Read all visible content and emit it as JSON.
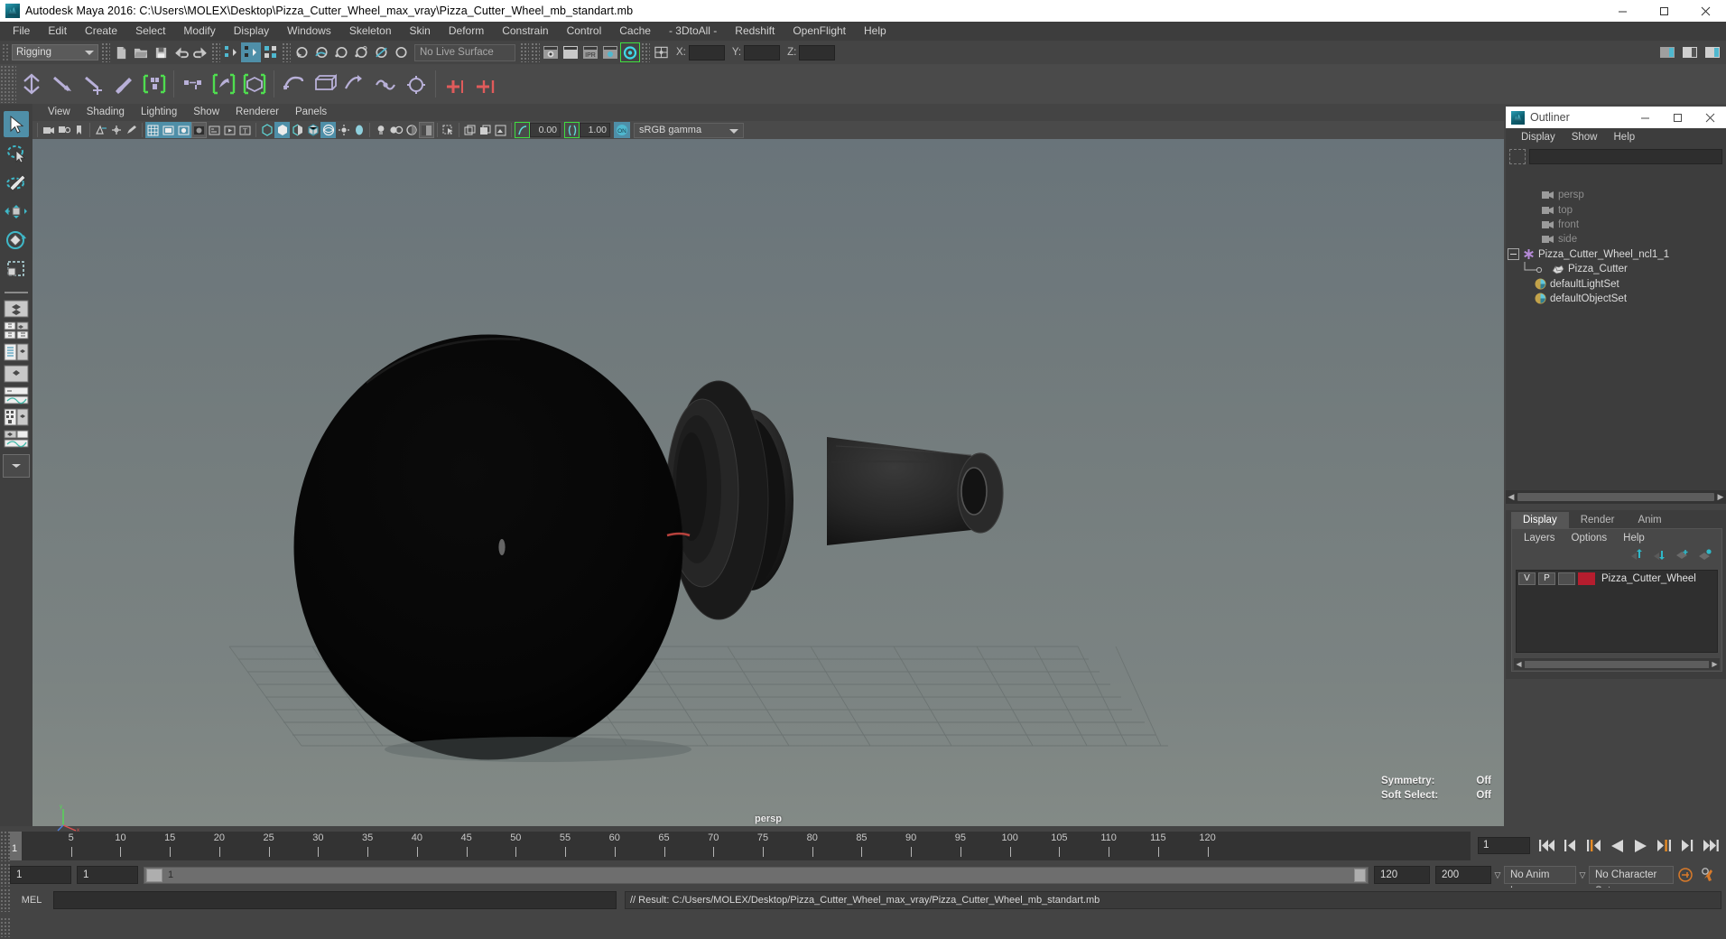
{
  "titlebar": {
    "title": "Autodesk Maya 2016: C:\\Users\\MOLEX\\Desktop\\Pizza_Cutter_Wheel_max_vray\\Pizza_Cutter_Wheel_mb_standart.mb",
    "app_icon": "maya-icon",
    "minimize": "—",
    "maximize": "☐",
    "close": "✕"
  },
  "menubar": {
    "items": [
      "File",
      "Edit",
      "Create",
      "Select",
      "Modify",
      "Display",
      "Windows",
      "Skeleton",
      "Skin",
      "Deform",
      "Constrain",
      "Control",
      "Cache",
      "- 3DtoAll -",
      "Redshift",
      "OpenFlight",
      "Help"
    ]
  },
  "statusline": {
    "menu_set": "Rigging",
    "live_surface": "No Live Surface",
    "coord_labels": {
      "x": "X:",
      "y": "Y:",
      "z": "Z:"
    },
    "coord_values": {
      "x": "",
      "y": "",
      "z": ""
    }
  },
  "panel": {
    "menu": [
      "View",
      "Shading",
      "Lighting",
      "Show",
      "Renderer",
      "Panels"
    ],
    "gamma_exposure": "0.00",
    "gamma_value": "1.00",
    "color_space": "sRGB gamma",
    "viewport_label": "persp",
    "hud": [
      {
        "label": "Symmetry:",
        "value": "Off"
      },
      {
        "label": "Soft Select:",
        "value": "Off"
      }
    ]
  },
  "outliner": {
    "title": "Outliner",
    "window_icon": "maya-icon",
    "minimize": "—",
    "maximize": "☐",
    "close": "✕",
    "menu": [
      "Display",
      "Show",
      "Help"
    ],
    "search_value": "",
    "items": [
      {
        "label": "persp",
        "icon": "camera-icon",
        "indent": 40,
        "dim": true
      },
      {
        "label": "top",
        "icon": "camera-icon",
        "indent": 40,
        "dim": true
      },
      {
        "label": "front",
        "icon": "camera-icon",
        "indent": 40,
        "dim": true
      },
      {
        "label": "side",
        "icon": "camera-icon",
        "indent": 40,
        "dim": true
      },
      {
        "label": "Pizza_Cutter_Wheel_ncl1_1",
        "icon": "asterisk-icon",
        "indent": 20,
        "dim": false,
        "expanded": true
      },
      {
        "label": "Pizza_Cutter",
        "icon": "mesh-icon",
        "indent": 48,
        "dim": false
      },
      {
        "label": "defaultLightSet",
        "icon": "set-icon",
        "indent": 32,
        "dim": false
      },
      {
        "label": "defaultObjectSet",
        "icon": "set-icon",
        "indent": 32,
        "dim": false
      }
    ]
  },
  "layer_editor": {
    "tabs": [
      "Display",
      "Render",
      "Anim"
    ],
    "active_tab": "Display",
    "menu": [
      "Layers",
      "Options",
      "Help"
    ],
    "toolbar_icons": [
      "move-layer-up-icon",
      "move-layer-down-icon",
      "new-layer-icon",
      "new-layer-from-selection-icon"
    ],
    "layers": [
      {
        "visibility": "V",
        "playback": "P",
        "shading": "",
        "color": "#b51d2e",
        "name": "Pizza_Cutter_Wheel"
      }
    ]
  },
  "timeline": {
    "ticks": [
      5,
      10,
      15,
      20,
      25,
      30,
      35,
      40,
      45,
      50,
      55,
      60,
      65,
      70,
      75,
      80,
      85,
      90,
      95,
      100,
      105,
      110,
      115,
      120
    ],
    "current_frame_marker": "1",
    "current_frame_field": "1",
    "playback_buttons": [
      "go-to-start-icon",
      "step-back-keyframe-icon",
      "step-back-frame-icon",
      "play-backwards-icon",
      "play-forwards-icon",
      "step-forward-frame-icon",
      "step-forward-keyframe-icon",
      "go-to-end-icon"
    ]
  },
  "range_slider": {
    "start_field": "1",
    "range_start_field": "1",
    "slider_label": "1",
    "range_end_field": "120",
    "end_field": "200",
    "anim_layer": "No Anim Layer",
    "character_set": "No Character Set"
  },
  "command_line": {
    "language": "MEL",
    "input_value": "",
    "result": "// Result: C:/Users/MOLEX/Desktop/Pizza_Cutter_Wheel_max_vray/Pizza_Cutter_Wheel_mb_standart.mb"
  },
  "toolbox": {
    "items": [
      {
        "name": "select-tool",
        "active": true
      },
      {
        "name": "lasso-select-tool",
        "active": false
      },
      {
        "name": "paint-select-tool",
        "active": false
      },
      {
        "name": "move-tool",
        "active": false
      },
      {
        "name": "rotate-tool",
        "active": false
      },
      {
        "name": "scale-tool",
        "active": false
      }
    ],
    "layout_items": [
      "single-perspective-layout",
      "four-view-layout",
      "outliner-persp-layout",
      "hypergraph-persp-layout",
      "persp-graph-editor-layout",
      "hypershade-persp-layout",
      "persp-outliner-graph-layout",
      "layout-menu"
    ]
  },
  "colors": {
    "accent": "#4f8fa8",
    "viewport_top": "#6c7678",
    "viewport_bottom": "#7e8684",
    "layer_color": "#b51d2e",
    "highlight_green": "#3fe03f",
    "playhead_orange": "#e58a25"
  }
}
